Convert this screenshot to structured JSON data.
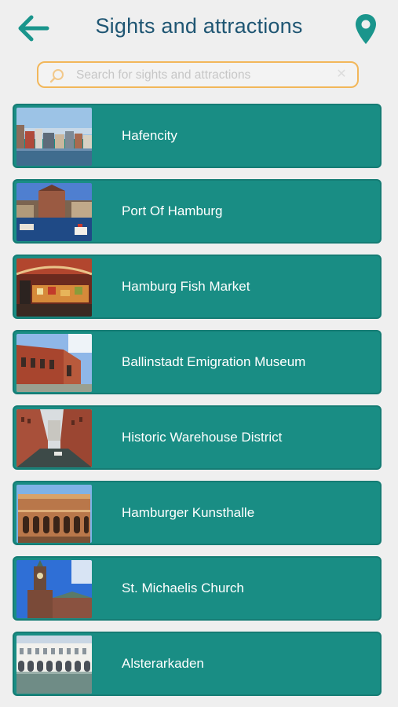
{
  "header": {
    "title": "Sights and attractions",
    "back_icon": "arrow-left-icon",
    "location_icon": "map-pin-icon",
    "accent_color": "#1a958c"
  },
  "search": {
    "placeholder": "Search for sights and attractions",
    "value": "",
    "search_icon": "magnifier-icon",
    "clear_icon": "clear-x-icon",
    "border_color": "#f2b75a"
  },
  "list_color": "#198d84",
  "items": [
    {
      "label": "Hafencity",
      "thumb": "harbour-city-photo"
    },
    {
      "label": "Port Of Hamburg",
      "thumb": "port-photo"
    },
    {
      "label": "Hamburg Fish Market",
      "thumb": "market-photo"
    },
    {
      "label": "Ballinstadt Emigration Museum",
      "thumb": "museum-photo"
    },
    {
      "label": "Historic Warehouse District",
      "thumb": "warehouse-photo"
    },
    {
      "label": "Hamburger Kunsthalle",
      "thumb": "kunsthalle-photo"
    },
    {
      "label": "St. Michaelis Church",
      "thumb": "church-photo"
    },
    {
      "label": "Alsterarkaden",
      "thumb": "arcades-photo"
    }
  ]
}
